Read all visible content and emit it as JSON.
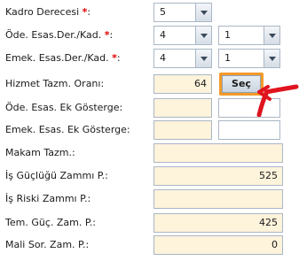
{
  "form": {
    "kadro_derecesi": {
      "label": "Kadro Derecesi",
      "required": "*",
      "value": "5"
    },
    "ode_esas": {
      "label": "Öde. Esas.Der./Kad.",
      "required": "*",
      "value1": "4",
      "value2": "1"
    },
    "emek_esas": {
      "label": "Emek. Esas.Der./Kad.",
      "required": "*",
      "value1": "4",
      "value2": "1"
    },
    "hizmet_tazm": {
      "label": "Hizmet Tazm. Oranı:",
      "value": "64",
      "button": "Seç"
    },
    "ode_ek_gosterge": {
      "label": "Öde. Esas. Ek Gösterge:",
      "value": "",
      "value2": ""
    },
    "emek_ek_gosterge": {
      "label": "Emek. Esas. Ek Gösterge:",
      "value": "",
      "value2": ""
    },
    "makam_tazm": {
      "label": "Makam Tazm.:",
      "value": ""
    },
    "is_guclugu": {
      "label": "İş Güçlüğü Zammı P.:",
      "value": "525"
    },
    "is_riski": {
      "label": "İş Riski Zammı P.:",
      "value": ""
    },
    "tem_guc": {
      "label": "Tem. Güç. Zam. P.:",
      "value": "425"
    },
    "mali_sor": {
      "label": "Mali Sor. Zam. P.:",
      "value": "0"
    }
  },
  "colors": {
    "required": "#e00000",
    "field_bg": "#fef3db",
    "button_highlight": "#f39a2a",
    "annotation_arrow": "#e0141e"
  },
  "icons": {
    "dropdown": "chevron-down-icon",
    "annotation": "red-arrow-annotation"
  }
}
